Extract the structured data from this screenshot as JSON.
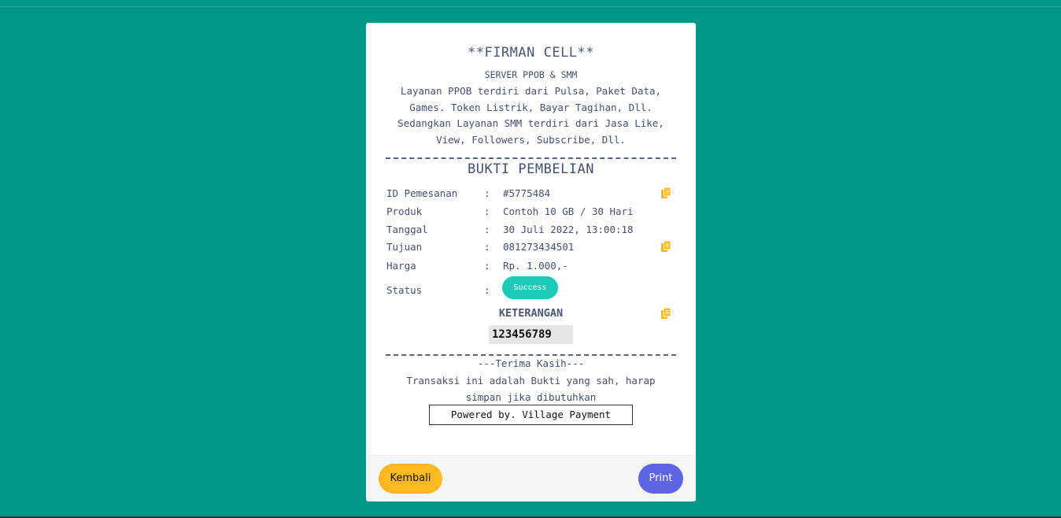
{
  "colors": {
    "background": "#009688",
    "card": "#ffffff",
    "status_success": "#1dc9b7",
    "copy_icon": "#ffb822",
    "back_button": "#ffb822",
    "print_button": "#5d65e3"
  },
  "header": {
    "store_name": "**FIRMAN CELL**",
    "server_label": "SERVER PPOB & SMM",
    "description_lines": [
      "Layanan PPOB terdiri dari Pulsa, Paket Data,",
      "Games. Token Listrik, Bayar Tagihan, Dll.",
      "Sedangkan Layanan SMM terdiri dari Jasa Like,",
      "View, Followers, Subscribe, Dll."
    ]
  },
  "receipt": {
    "title": "BUKTI PEMBELIAN",
    "separator": ":",
    "rows": [
      {
        "label": "ID Pemesanan",
        "value": "#5775484",
        "copy_icon": "copy-icon"
      },
      {
        "label": "Produk",
        "value": "Contoh 10 GB / 30 Hari"
      },
      {
        "label": "Tanggal",
        "value": "30 Juli 2022, 13:00:18"
      },
      {
        "label": "Tujuan",
        "value": "081273434501",
        "copy_icon": "copy-icon"
      },
      {
        "label": "Harga",
        "value": "Rp. 1.000,-"
      }
    ],
    "status": {
      "label": "Status",
      "value": "Success"
    },
    "keterangan": {
      "title": "KETERANGAN",
      "value": "123456789",
      "copy_icon": "copy-icon"
    }
  },
  "footer_note": {
    "thanks": "---Terima Kasih---",
    "note_lines": [
      "Transaksi ini adalah Bukti yang sah, harap",
      "simpan jika dibutuhkan"
    ],
    "powered_by": "Powered by. Village Payment"
  },
  "actions": {
    "back_label": "Kembali",
    "print_label": "Print"
  }
}
